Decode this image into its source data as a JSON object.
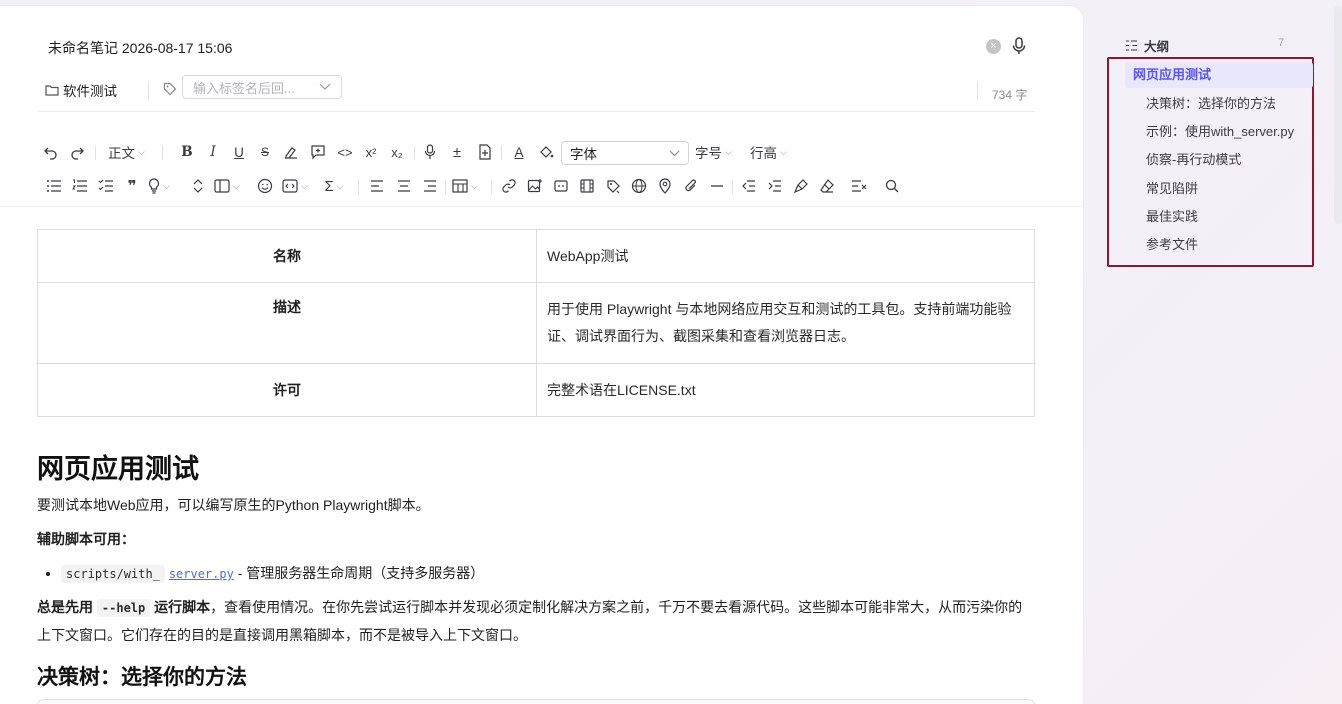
{
  "note": {
    "title": "未命名笔记 2026-08-17 15:06",
    "folder": "软件测试",
    "tag_placeholder": "输入标签名后回...",
    "word_count": "734 字"
  },
  "toolbar": {
    "paragraph_style": "正文",
    "font_select": "字体",
    "font_size": "字号",
    "line_height": "行高",
    "icons_row1": [
      "undo-icon",
      "redo-icon",
      "bold-icon",
      "italic-icon",
      "underline-icon",
      "strikethrough-icon",
      "highlighter-icon",
      "comment-icon",
      "code-icon",
      "superscript-icon",
      "subscript-icon",
      "voice-icon",
      "plus-minus-icon",
      "insert-doc-icon",
      "font-color-icon",
      "fill-color-icon"
    ],
    "icons_row2": [
      "bullet-list-icon",
      "ordered-list-icon",
      "task-list-icon",
      "quote-icon",
      "idea-icon",
      "expand-icon",
      "layout-icon",
      "emoji-icon",
      "embed-icon",
      "formula-icon",
      "align-left-icon",
      "align-center-icon",
      "align-right-icon",
      "table-icon",
      "link-icon",
      "image-icon",
      "media-icon",
      "film-icon",
      "brush-icon",
      "globe-icon",
      "location-icon",
      "attachment-icon",
      "hr-icon",
      "outdent-icon",
      "indent-icon",
      "format-painter-icon",
      "eraser-icon",
      "clear-format-icon",
      "search-icon"
    ]
  },
  "content": {
    "table": [
      {
        "key": "名称",
        "value": "WebApp测试"
      },
      {
        "key": "描述",
        "value": "用于使用 Playwright 与本地网络应用交互和测试的工具包。支持前端功能验证、调试界面行为、截图采集和查看浏览器日志。"
      },
      {
        "key": "许可",
        "value": "完整术语在LICENSE.txt"
      }
    ],
    "h1": "网页应用测试",
    "intro": "要测试本地Web应用，可以编写原生的Python Playwright脚本。",
    "helper_heading": "辅助脚本可用：",
    "bullet_code": "scripts/with_",
    "bullet_link": "server.py",
    "bullet_text": "- 管理服务器生命周期（支持多服务器）",
    "p2_bold_a": "总是先用",
    "p2_code": "--help",
    "p2_bold_b": "运行脚本",
    "p2_rest": "，查看使用情况。在你先尝试运行脚本并发现必须定制化解决方案之前，千万不要去看源代码。这些脚本可能非常大，从而污染你的上下文窗口。它们存在的目的是直接调用黑箱脚本，而不是被导入上下文窗口。",
    "h2": "决策树：选择你的方法"
  },
  "outline": {
    "title": "大纲",
    "count": "7",
    "items": [
      "网页应用测试",
      "决策树：选择你的方法",
      "示例：使用with_server.py",
      "侦察-再行动模式",
      "常见陷阱",
      "最佳实践",
      "参考文件"
    ],
    "active_index": 0
  },
  "colors": {
    "accent": "#5b56e8",
    "outline_active_bg": "#e8e7fb",
    "highlight_box": "#8b1a2c"
  }
}
